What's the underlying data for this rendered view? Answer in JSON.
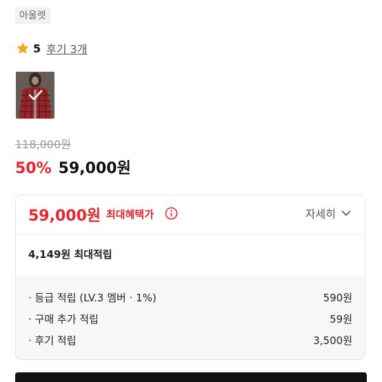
{
  "brand_tag": "아울렛",
  "rating": {
    "score": "5",
    "review_link": "후기 3개"
  },
  "thumbnail": {
    "selected": true
  },
  "price": {
    "original": "118,000원",
    "discount_rate": "50%",
    "sale": "59,000원"
  },
  "benefit": {
    "max_price": "59,000원",
    "max_label": "최대혜택가",
    "detail_label": "자세히",
    "accrual_title": "4,149원 최대적립",
    "items": [
      {
        "label": "· 등급 적립 (LV.3 멤버 · 1%)",
        "value": "590원"
      },
      {
        "label": "· 구매 추가 적립",
        "value": "59원"
      },
      {
        "label": "· 후기 적립",
        "value": "3,500원"
      }
    ]
  },
  "colors": {
    "accent": "#e5262e",
    "star": "#f5a623"
  }
}
